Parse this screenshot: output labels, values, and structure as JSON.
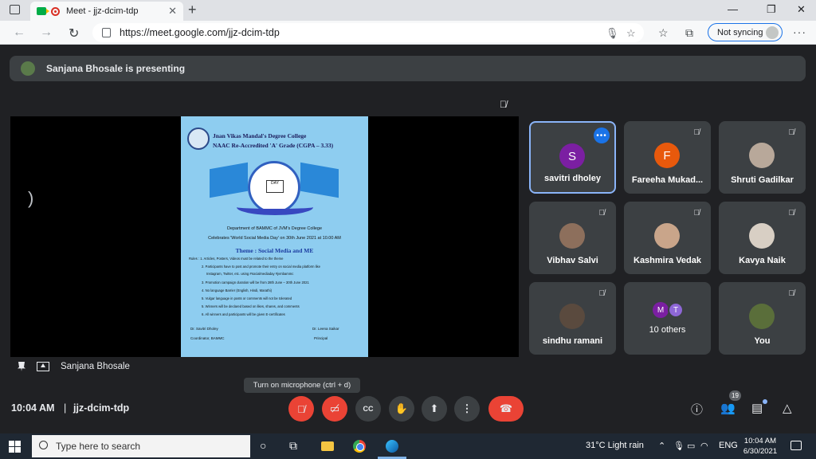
{
  "browser": {
    "tab_title": "Meet - jjz-dcim-tdp",
    "url": "https://meet.google.com/jjz-dcim-tdp",
    "sync_label": "Not syncing"
  },
  "banner": {
    "text": "Sanjana Bhosale is presenting"
  },
  "presentation": {
    "presenter_label": "Sanjana Bhosale",
    "poster": {
      "college_line1": "Jnan Vikas Mandal's Degree College",
      "college_line2": "NAAC Re-Accredited 'A' Grade (CGPA – 3.33)",
      "badge_text": "DAY",
      "dept_line": "Department of BAMMC of JVM's Degree College",
      "celebrates_line": "Celebrates 'World Social Media Day' on 30th June 2021 at 10.00 AM",
      "theme": "Theme : Social Media and ME",
      "rules": [
        "Rules : 1. Articles, Posters, Videos must be related to the theme",
        "2. Participants have to post and promote their entry on social media platform like",
        "Instagram, Twitter, etc. using #socialmediaday #jvmbammc",
        "3. Promotion campaign duration will be from 28th June – 30th June 2021",
        "4. No language Barrier (English, Hindi, Marathi)",
        "5. Vulgar language in posts or comments will not be tolerated",
        "5. Winners will be declared based on likes, shares, and comments",
        "6. All winners and participants will be given E-certificates"
      ],
      "sig_left_name": "Dr. Savitri Dholey",
      "sig_left_role": "Coordinator, BAMMC",
      "sig_right_name": "Dr. Leena Saikar",
      "sig_right_role": "Principal"
    }
  },
  "participants": [
    {
      "name": "savitri dholey",
      "initial": "S",
      "color": "#7b1fa2"
    },
    {
      "name": "Fareeha Mukad...",
      "initial": "F",
      "color": "#e8590c"
    },
    {
      "name": "Shruti Gadilkar"
    },
    {
      "name": "Vibhav Salvi"
    },
    {
      "name": "Kashmira Vedak"
    },
    {
      "name": "Kavya Naik"
    },
    {
      "name": "sindhu ramani"
    },
    {
      "name": "10 others",
      "initials": [
        "M",
        "T"
      ]
    },
    {
      "name": "You"
    }
  ],
  "controls": {
    "tooltip": "Turn on microphone (ctrl + d)",
    "time": "10:04 AM",
    "separator": "|",
    "meeting_code": "jjz-dcim-tdp",
    "people_count": "19"
  },
  "taskbar": {
    "search_placeholder": "Type here to search",
    "weather": "31°C  Light rain",
    "lang": "ENG",
    "clock_time": "10:04 AM",
    "clock_date": "6/30/2021"
  },
  "colors": {
    "accent": "#8ab4f8",
    "end_call": "#ea4335",
    "tile_bg": "#3c4043"
  }
}
